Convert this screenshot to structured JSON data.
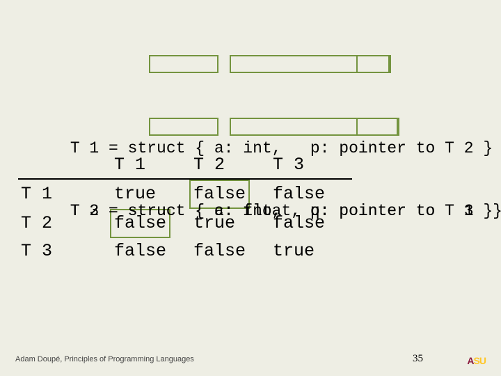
{
  "defs": {
    "line1": "T 1 = struct { a: int,   p: pointer to T 2 }",
    "line2": "T 2 = struct { c: int,   q: pointer to T 3  }",
    "line3": "T 3 = struct { a: float, p: pointer to T 1 }"
  },
  "table": {
    "cols": [
      "T 1",
      "T 2",
      "T 3"
    ],
    "rows": [
      "T 1",
      "T 2",
      "T 3"
    ],
    "cells": [
      [
        "true",
        "false",
        "false"
      ],
      [
        "false",
        "true",
        "false"
      ],
      [
        "false",
        "false",
        "true"
      ]
    ]
  },
  "footer": {
    "credits": "Adam Doupé, Principles of Programming Languages",
    "pagenum": "35",
    "logo_a": "A",
    "logo_su": "SU"
  }
}
